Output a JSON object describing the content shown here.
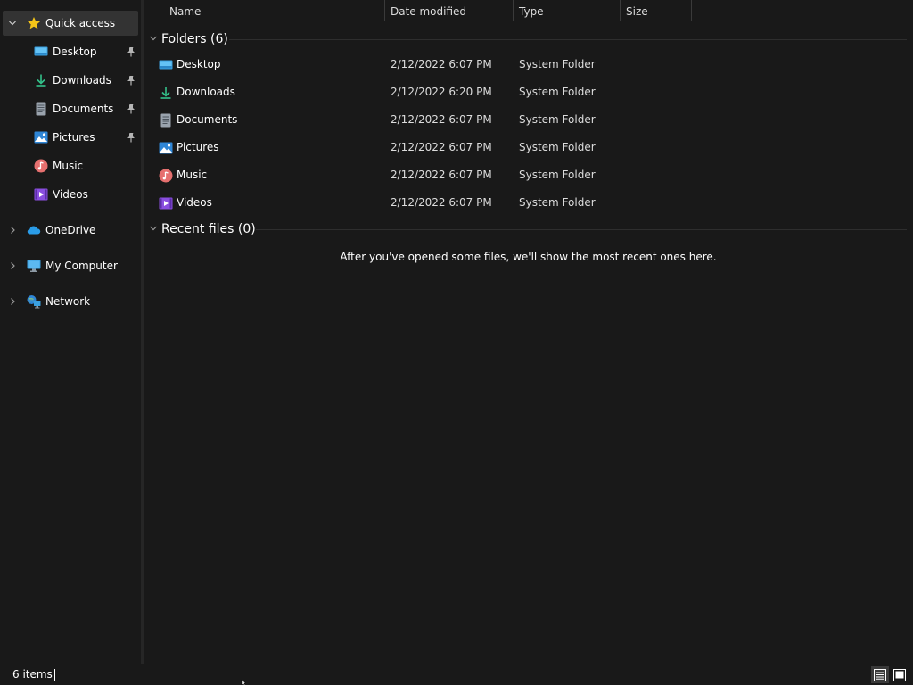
{
  "nav": {
    "quick_access": "Quick access",
    "pinned": [
      {
        "label": "Desktop",
        "icon": "desktop-icon"
      },
      {
        "label": "Downloads",
        "icon": "downloads-icon"
      },
      {
        "label": "Documents",
        "icon": "documents-icon"
      },
      {
        "label": "Pictures",
        "icon": "pictures-icon"
      },
      {
        "label": "Music",
        "icon": "music-icon"
      },
      {
        "label": "Videos",
        "icon": "videos-icon"
      }
    ],
    "onedrive": "OneDrive",
    "my_computer": "My Computer",
    "network": "Network"
  },
  "columns": {
    "name": "Name",
    "date_modified": "Date modified",
    "type": "Type",
    "size": "Size"
  },
  "groups": {
    "folders_title": "Folders (6)",
    "recent_title": "Recent files (0)",
    "recent_empty": "After you've opened some files, we'll show the most recent ones here."
  },
  "folders": [
    {
      "name": "Desktop",
      "date": "2/12/2022 6:07 PM",
      "type": "System Folder",
      "icon": "desktop-icon"
    },
    {
      "name": "Downloads",
      "date": "2/12/2022 6:20 PM",
      "type": "System Folder",
      "icon": "downloads-icon"
    },
    {
      "name": "Documents",
      "date": "2/12/2022 6:07 PM",
      "type": "System Folder",
      "icon": "documents-icon"
    },
    {
      "name": "Pictures",
      "date": "2/12/2022 6:07 PM",
      "type": "System Folder",
      "icon": "pictures-icon"
    },
    {
      "name": "Music",
      "date": "2/12/2022 6:07 PM",
      "type": "System Folder",
      "icon": "music-icon"
    },
    {
      "name": "Videos",
      "date": "2/12/2022 6:07 PM",
      "type": "System Folder",
      "icon": "videos-icon"
    }
  ],
  "status": {
    "item_count": "6 items"
  },
  "colors": {
    "background": "#191919",
    "selected": "#333333",
    "text": "#ffffff"
  }
}
